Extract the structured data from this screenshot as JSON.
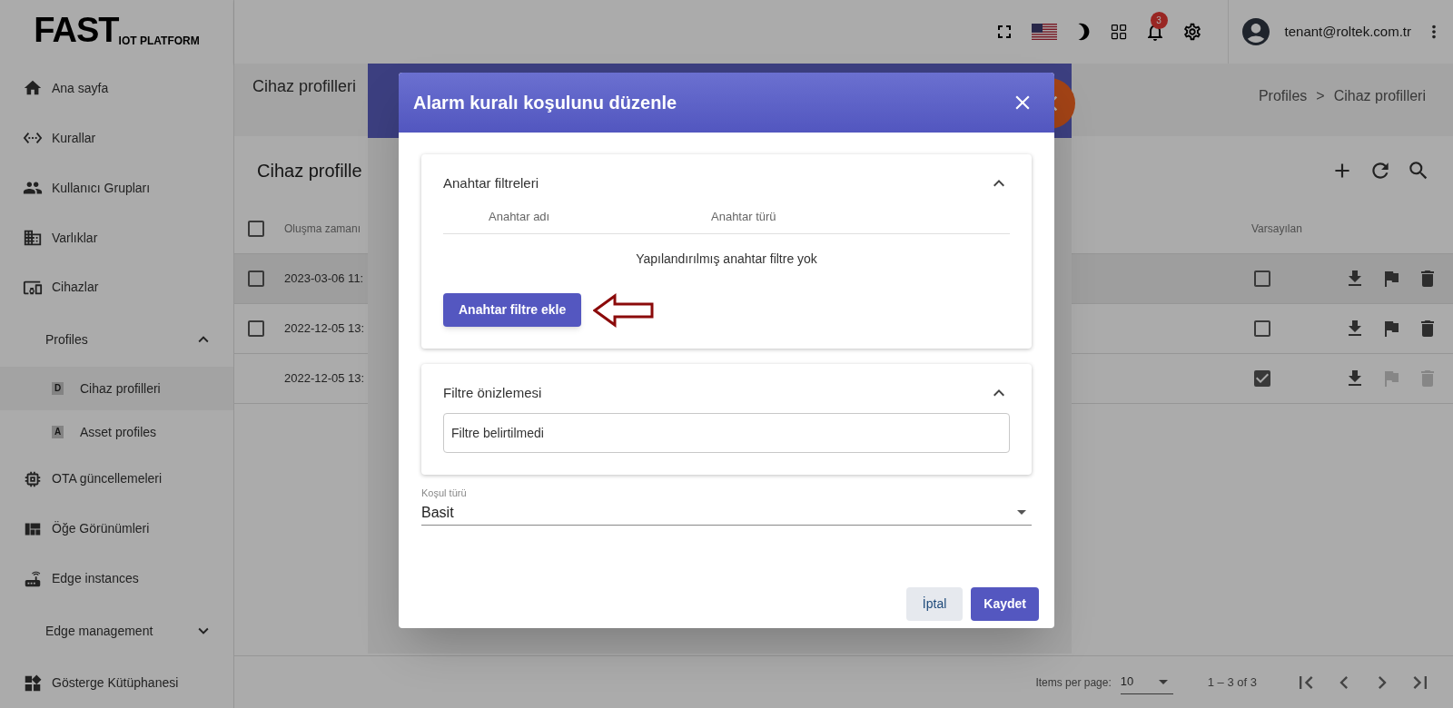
{
  "logo": {
    "main": "FAST",
    "sub": "IOT PLATFORM"
  },
  "sidebar": {
    "items": [
      {
        "kind": "link",
        "label": "Ana sayfa"
      },
      {
        "kind": "link",
        "label": "Kurallar"
      },
      {
        "kind": "link",
        "label": "Kullanıcı Grupları"
      },
      {
        "kind": "link",
        "label": "Varlıklar"
      },
      {
        "kind": "link",
        "label": "Cihazlar"
      },
      {
        "kind": "group",
        "label": "Profiles",
        "expanded": true,
        "children": [
          {
            "label": "Cihaz profilleri",
            "badge": "D",
            "selected": true
          },
          {
            "label": "Asset profiles",
            "badge": "A",
            "selected": false
          }
        ]
      },
      {
        "kind": "link",
        "label": "OTA güncellemeleri"
      },
      {
        "kind": "link",
        "label": "Öğe Görünümleri"
      },
      {
        "kind": "link",
        "label": "Edge instances"
      },
      {
        "kind": "group",
        "label": "Edge management",
        "expanded": false
      },
      {
        "kind": "link",
        "label": "Gösterge Kütüphanesi"
      }
    ]
  },
  "topbar": {
    "notifications": "3",
    "user": "tenant@roltek.com.tr"
  },
  "page": {
    "title": "Cihaz profilleri",
    "breadcrumb": [
      "Profiles",
      "Cihaz profilleri"
    ],
    "breadcrumb_separator": ">",
    "table_title": "Cihaz profille",
    "columns": [
      "Oluşma zamanı",
      "Varsayılan"
    ],
    "header_checked": false,
    "rows": [
      {
        "created": "2023-03-06 11:",
        "selectable": true,
        "checked": false,
        "selected": true,
        "default": false,
        "actions_disabled": false
      },
      {
        "created": "2022-12-05 13:",
        "selectable": true,
        "checked": false,
        "selected": false,
        "default": false,
        "actions_disabled": false
      },
      {
        "created": "2022-12-05 13:",
        "selectable": false,
        "selected": false,
        "default": true,
        "actions_disabled": true
      }
    ],
    "pagination": {
      "label": "Items per page:",
      "page_size": "10",
      "range": "1 – 3 of 3"
    }
  },
  "dialog": {
    "title": "Alarm kuralı koşulunu düzenle",
    "sections": [
      {
        "kind": "table",
        "title": "Anahtar filtreleri",
        "expanded": true,
        "columns": [
          "Anahtar adı",
          "Anahtar türü"
        ],
        "empty": "Yapılandırılmış anahtar filtre yok",
        "button": "Anahtar filtre ekle"
      },
      {
        "kind": "preview",
        "title": "Filtre önizlemesi",
        "expanded": true,
        "value": "Filtre belirtilmedi"
      }
    ],
    "condition": {
      "label": "Koşul türü",
      "value": "Basit"
    },
    "buttons": [
      {
        "kind": "cancel",
        "label": "İptal"
      },
      {
        "kind": "save",
        "label": "Kaydet"
      }
    ]
  }
}
